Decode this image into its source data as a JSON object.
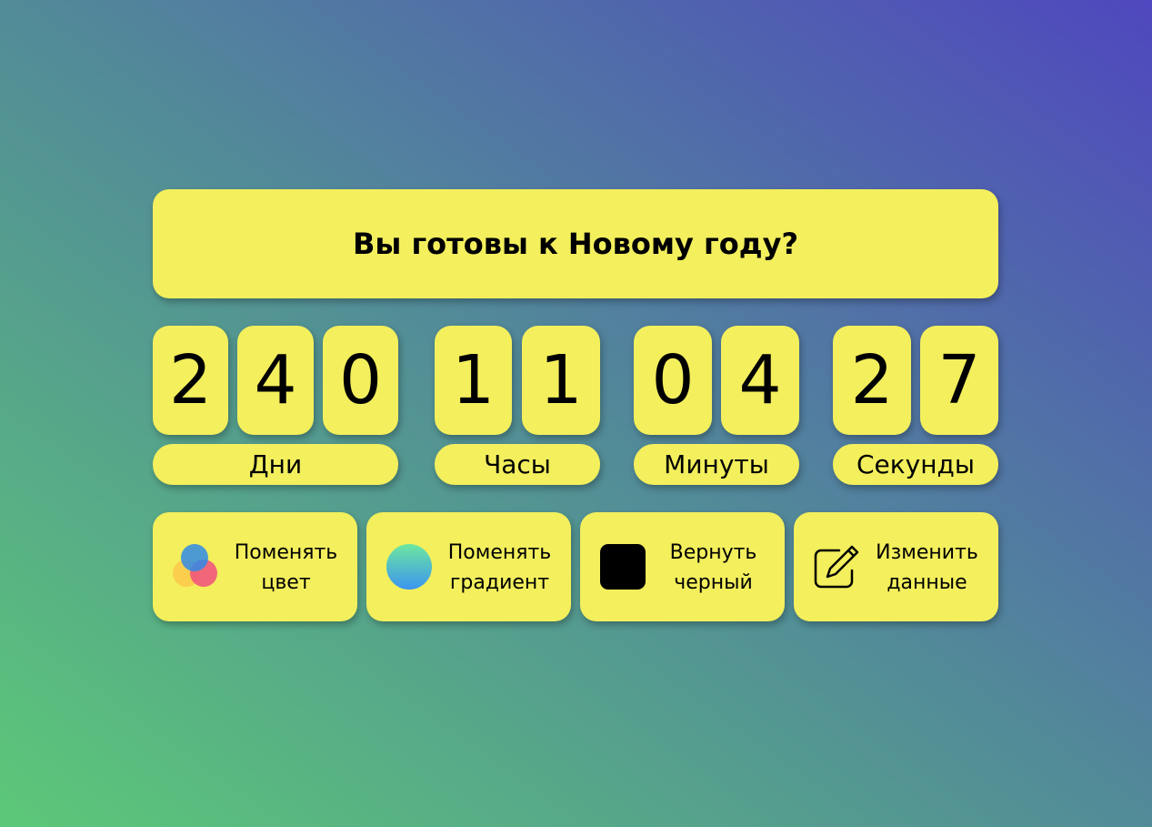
{
  "title": "Вы готовы к Новому году?",
  "countdown": {
    "days": {
      "digits": [
        "2",
        "4",
        "0"
      ],
      "label": "Дни"
    },
    "hours": {
      "digits": [
        "1",
        "1"
      ],
      "label": "Часы"
    },
    "minutes": {
      "digits": [
        "0",
        "4"
      ],
      "label": "Минуты"
    },
    "seconds": {
      "digits": [
        "2",
        "7"
      ],
      "label": "Секунды"
    }
  },
  "actions": [
    {
      "icon": "color-circles-icon",
      "line1": "Поменять",
      "line2": "цвет"
    },
    {
      "icon": "gradient-circle-icon",
      "line1": "Поменять",
      "line2": "градиент"
    },
    {
      "icon": "black-square-icon",
      "line1": "Вернуть",
      "line2": "черный"
    },
    {
      "icon": "edit-icon",
      "line1": "Изменить",
      "line2": "данные"
    }
  ],
  "colors": {
    "card": "#f3ef5d",
    "background_start": "#5cc878",
    "background_end": "#4f47be"
  }
}
